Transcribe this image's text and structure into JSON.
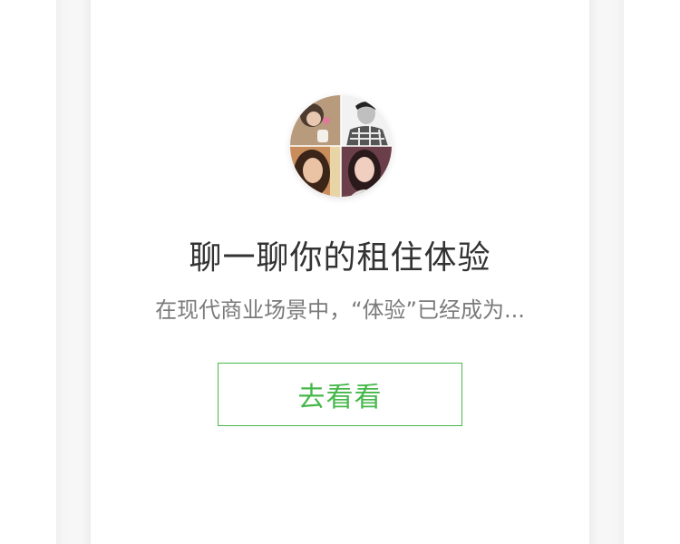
{
  "promo": {
    "title": "聊一聊你的租住体验",
    "subtitle": "在现代商业场景中，“体验”已经成为...",
    "button_label": "去看看"
  },
  "avatar": {
    "type": "user-photo-collage",
    "count": 4
  },
  "colors": {
    "accent": "#46b84a",
    "title": "#333333",
    "subtitle": "#7a7a7a",
    "background": "#f7f7f7"
  }
}
